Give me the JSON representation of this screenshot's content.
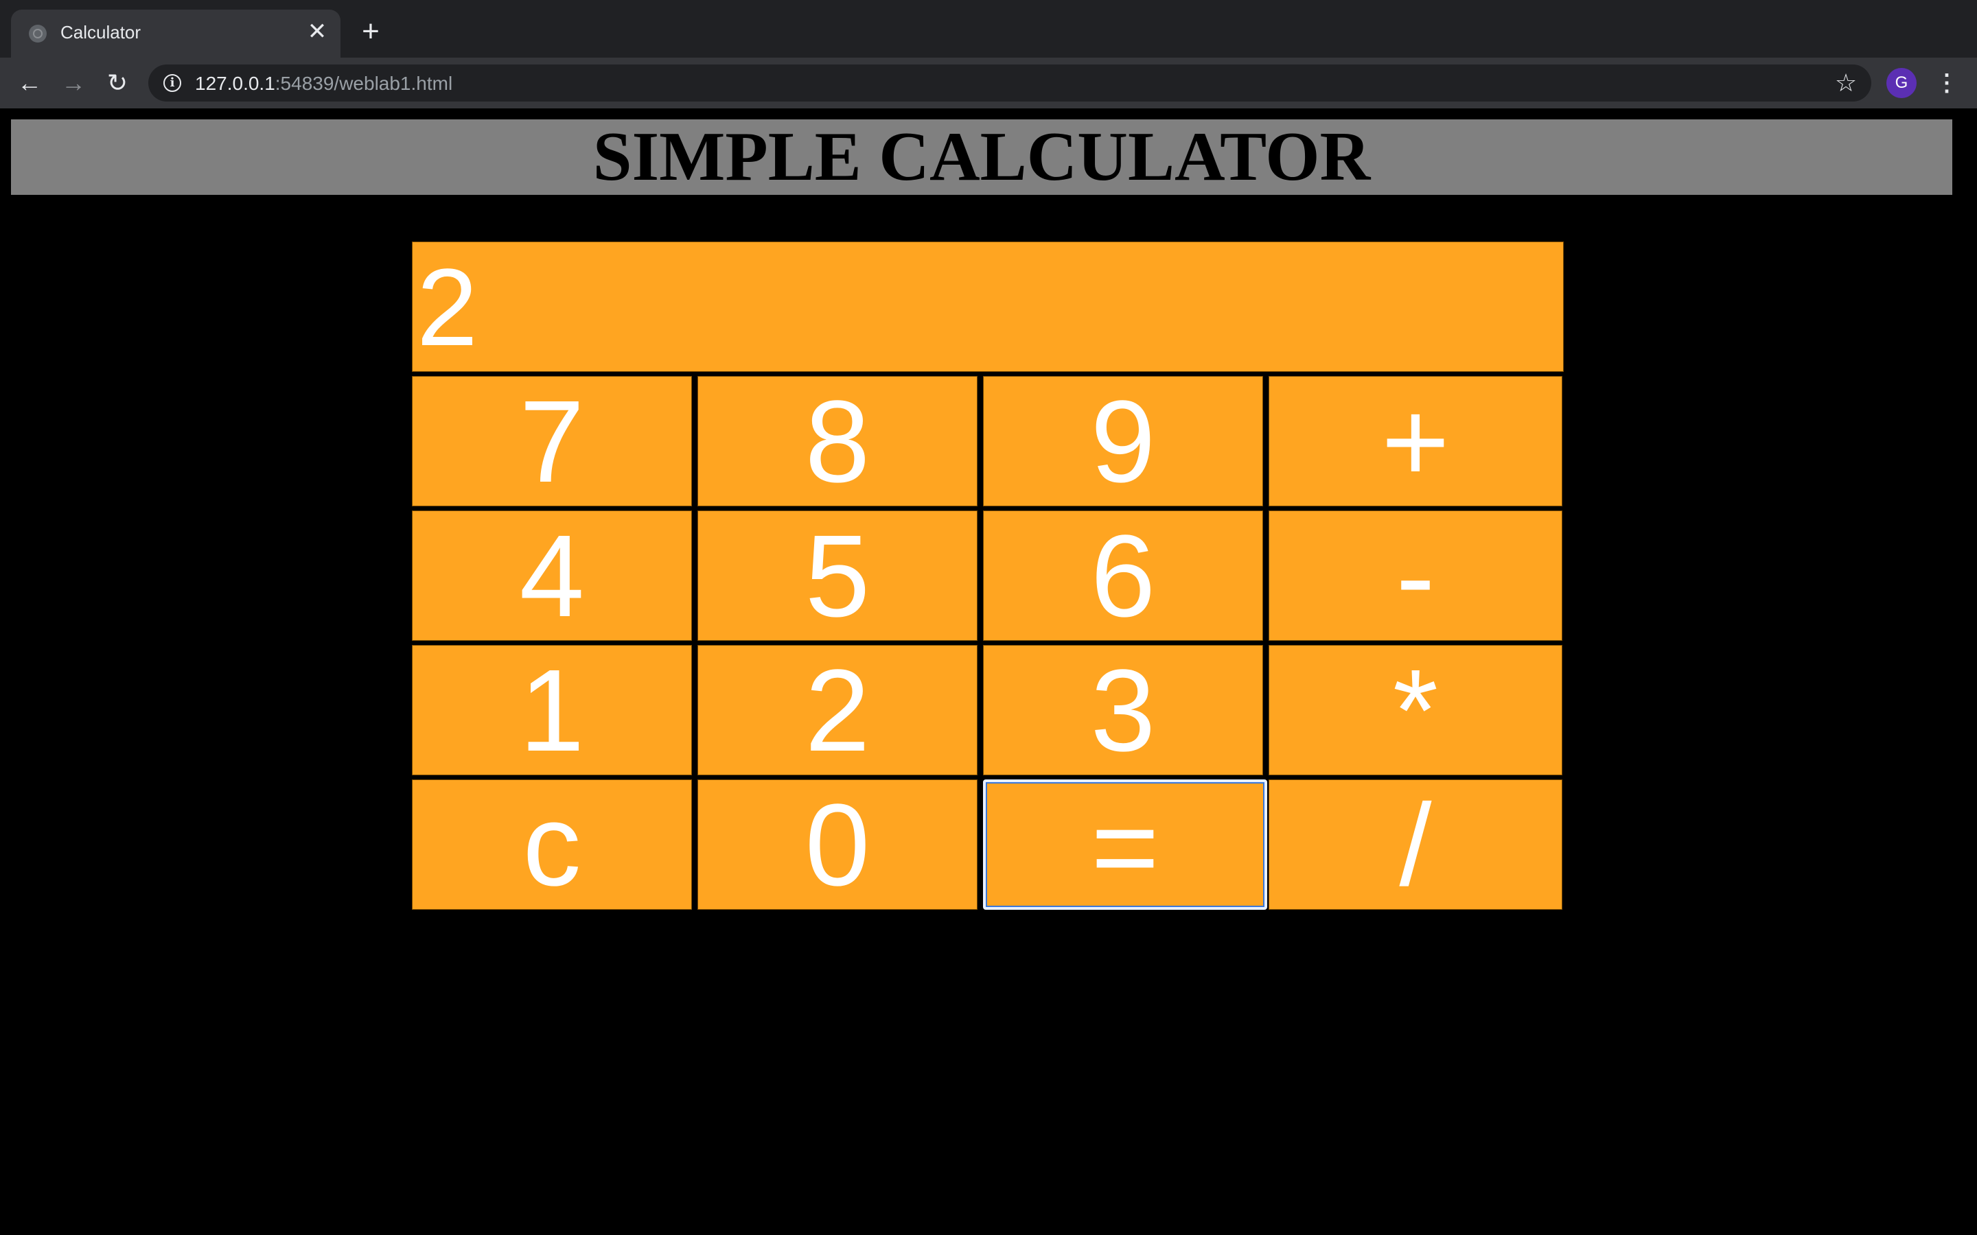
{
  "browser": {
    "tab_title": "Calculator",
    "tab_close": "✕",
    "new_tab": "+",
    "url_host": "127.0.0.1",
    "url_rest": ":54839/weblab1.html",
    "avatar_letter": "G"
  },
  "page": {
    "title": "SIMPLE CALCULATOR",
    "display_value": "2"
  },
  "keys": [
    "7",
    "8",
    "9",
    "+",
    "4",
    "5",
    "6",
    "-",
    "1",
    "2",
    "3",
    "*",
    "c",
    "0",
    "=",
    "/"
  ],
  "colors": {
    "key_background": "#ffa521",
    "header_background": "#808080",
    "page_background": "#000000",
    "focused_key": "="
  }
}
